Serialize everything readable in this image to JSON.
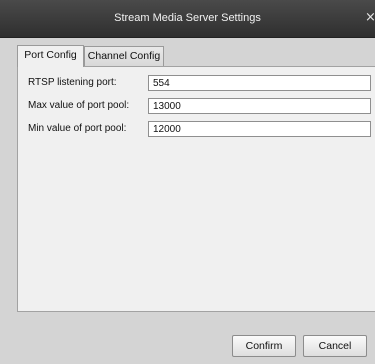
{
  "window": {
    "title": "Stream Media Server Settings",
    "close_glyph": "×"
  },
  "tabs": [
    {
      "label": "Port Config",
      "active": true
    },
    {
      "label": "Channel Config",
      "active": false
    }
  ],
  "port_config": {
    "fields": [
      {
        "label": "RTSP listening port:",
        "value": "554"
      },
      {
        "label": "Max value of port pool:",
        "value": "13000"
      },
      {
        "label": "Min value of port pool:",
        "value": "12000"
      }
    ]
  },
  "footer": {
    "confirm_label": "Confirm",
    "cancel_label": "Cancel"
  },
  "colors": {
    "titlebar": "#3a3a3a",
    "dialog_bg": "#d4d4d4",
    "panel_bg": "#f0f0f0"
  }
}
